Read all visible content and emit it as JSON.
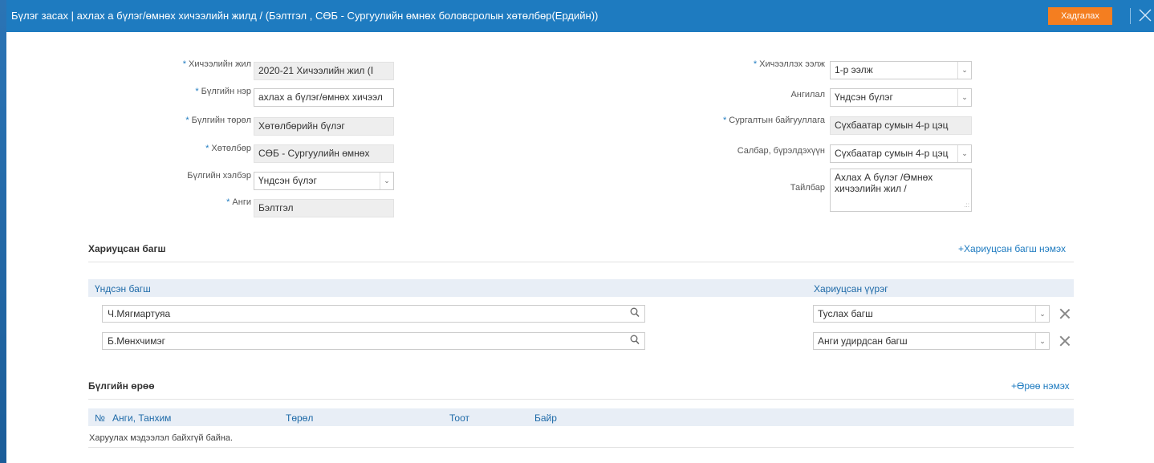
{
  "title": "Бүлэг засах | ахлах а бүлэг/өмнөх хичээлийн жилд / (Бэлтгэл , СӨБ - Сургуулийн өмнөх боловсролын хөтөлбөр(Ердийн))",
  "save_label": "Хадгалах",
  "left_fields": [
    {
      "label": "Хичээлийн жил",
      "required": true,
      "value": "2020-21 Хичээлийн жил (Ⅰ"
    },
    {
      "label": "Бүлгийн нэр",
      "required": true,
      "value": "ахлах  а бүлэг/өмнөх хичээл"
    },
    {
      "label": "Бүлгийн төрөл",
      "required": true,
      "value": "Хөтөлбөрийн бүлэг"
    },
    {
      "label": "Хөтөлбөр",
      "required": true,
      "value": "СӨБ - Сургуулийн өмнөх"
    },
    {
      "label": "Бүлгийн хэлбэр",
      "required": false,
      "value": "Үндсэн бүлэг"
    },
    {
      "label": "Анги",
      "required": true,
      "value": "Бэлтгэл"
    }
  ],
  "right_fields": [
    {
      "label": "Хичээллэх ээлж",
      "required": true,
      "value": "1-р ээлж"
    },
    {
      "label": "Ангилал",
      "required": false,
      "value": "Үндсэн бүлэг"
    },
    {
      "label": "Сургалтын байгууллага",
      "required": true,
      "value": "Сүхбаатар сумын 4-р цэц"
    },
    {
      "label": "Салбар, бүрэлдэхүүн",
      "required": false,
      "value": "Сүхбаатар сумын 4-р цэц"
    },
    {
      "label": "Тайлбар",
      "required": false,
      "value": "Ахлах А бүлэг /Өмнөх хичээлийн жил /"
    }
  ],
  "teachers_section": {
    "title": "Хариуцсан багш",
    "add_link": "+Хариуцсан багш нэмэх",
    "col_teacher": "Үндсэн багш",
    "col_role": "Хариуцсан үүрэг",
    "rows": [
      {
        "teacher": "Ч.Мягмартуяа",
        "role": "Туслах багш"
      },
      {
        "teacher": "Б.Мөнхчимэг",
        "role": "Анги удирдсан багш"
      }
    ]
  },
  "rooms_section": {
    "title": "Бүлгийн өрөө",
    "add_link": "+Өрөө нэмэх",
    "columns": [
      "№",
      "Анги, Танхим",
      "Төрөл",
      "Тоот",
      "Байр"
    ],
    "empty_text": "Харуулах мэдээлэл байхгүй байна."
  },
  "icons": {
    "search": "search-icon",
    "close": "close-icon",
    "chevron": "chevron-down-icon"
  },
  "colors": {
    "header": "#1e7bc0",
    "save": "#f47e20"
  }
}
